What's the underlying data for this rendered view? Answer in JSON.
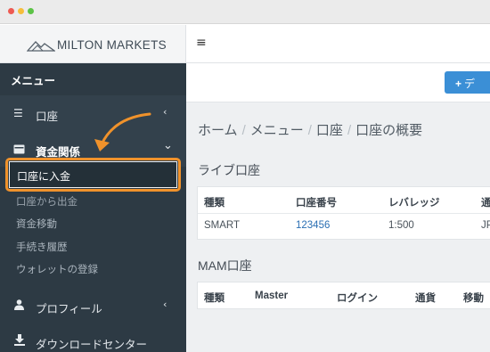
{
  "window": {
    "controls": [
      "close",
      "minimize",
      "maximize"
    ]
  },
  "brand": {
    "name": "MILTON MARKETS",
    "logo_icon": "mountain-logo-icon"
  },
  "sidebar": {
    "menu_title": "メニュー",
    "items": [
      {
        "label": "口座",
        "icon": "list-icon",
        "chevron": "‹"
      },
      {
        "label": "資金関係",
        "icon": "wallet-icon",
        "chevron": "⌄",
        "subitems": [
          "口座に入金",
          "口座から出金",
          "資金移動",
          "手続き履歴",
          "ウォレットの登録"
        ]
      },
      {
        "label": "プロフィール",
        "icon": "user-icon",
        "chevron": "‹"
      },
      {
        "label": "ダウンロードセンター",
        "icon": "download-icon"
      }
    ]
  },
  "topbar": {
    "menu_icon": "hamburger-icon"
  },
  "actionbar": {
    "button_label": "デ"
  },
  "breadcrumb": [
    "ホーム",
    "メニュー",
    "口座",
    "口座の概要"
  ],
  "live": {
    "title": "ライブ口座",
    "headers": [
      "種類",
      "口座番号",
      "レバレッジ",
      "通"
    ],
    "row": [
      "SMART",
      "123456",
      "1:500",
      "JP"
    ]
  },
  "mam": {
    "title": "MAM口座",
    "headers": [
      "種類",
      "Master",
      "ログイン",
      "通貨",
      "移動"
    ]
  },
  "colors": {
    "sidebar": "#2d3a44",
    "accent": "#f0922b",
    "button": "#3b8fd6",
    "link": "#2a6fb3"
  }
}
